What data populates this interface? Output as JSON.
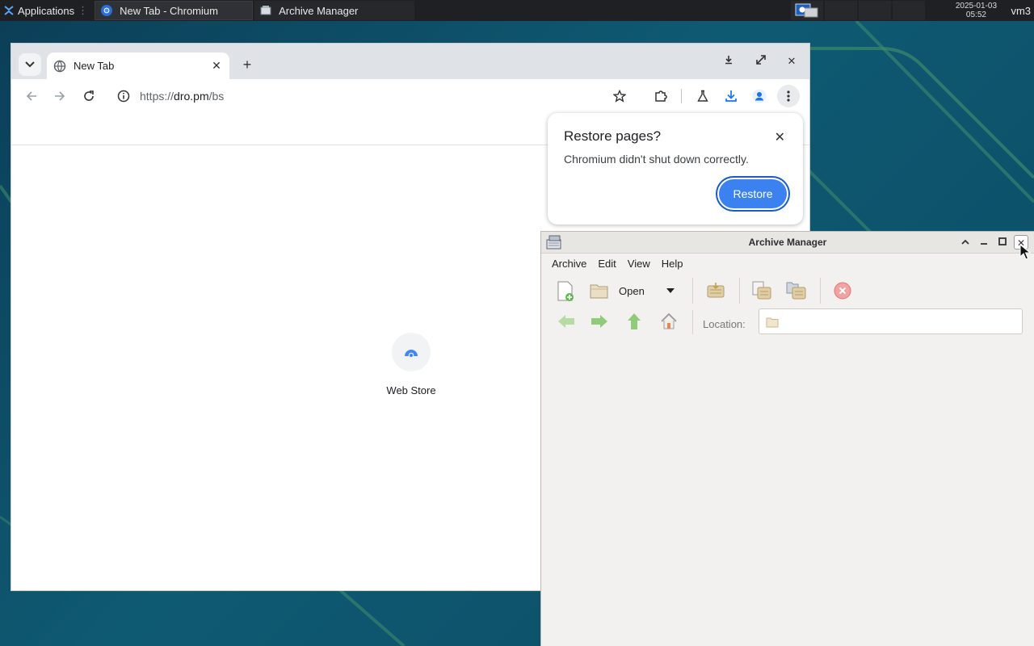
{
  "taskbar": {
    "apps_label": "Applications",
    "tasks": [
      {
        "label": "New Tab - Chromium"
      },
      {
        "label": "Archive Manager"
      }
    ],
    "clock_date": "2025-01-03",
    "clock_time": "05:52",
    "user": "vm3"
  },
  "chromium": {
    "tab_title": "New Tab",
    "url_prefix": "https://",
    "url_domain": "dro.pm",
    "url_path": "/bs",
    "shortcut_label": "Web Store",
    "restore_bubble": {
      "title": "Restore pages?",
      "message": "Chromium didn't shut down correctly.",
      "button": "Restore"
    }
  },
  "archive_manager": {
    "title": "Archive Manager",
    "menu": [
      "Archive",
      "Edit",
      "View",
      "Help"
    ],
    "open_label": "Open",
    "location_label": "Location:",
    "location_value": ""
  },
  "colors": {
    "desktop": "#0e4d66",
    "taskbar": "#1f2024",
    "chrome_accent": "#3b82f0",
    "archive_bg": "#f2f1f0"
  }
}
